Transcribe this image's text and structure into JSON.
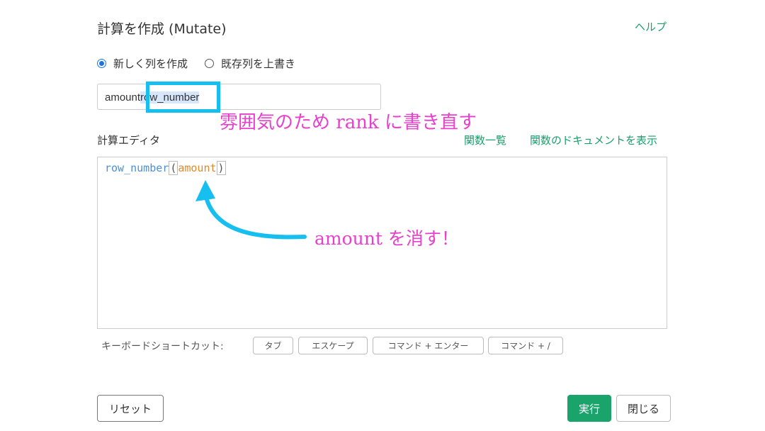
{
  "dialog": {
    "title": "計算を作成 (Mutate)",
    "help_label": "ヘルプ"
  },
  "mode": {
    "options": [
      {
        "label": "新しく列を作成",
        "selected": true
      },
      {
        "label": "既存列を上書き",
        "selected": false
      }
    ]
  },
  "column_name": {
    "value_prefix": "amount",
    "value_selected": "row_number"
  },
  "annotations": {
    "rename_note": "雰囲気のため rank に書き直す",
    "delete_note": "amount を消す！"
  },
  "editor": {
    "label": "計算エディタ",
    "function_list_link": "関数一覧",
    "function_docs_link": "関数のドキュメントを表示",
    "code": {
      "function": "row_number",
      "open_paren": "(",
      "argument": "amount",
      "close_paren": ")"
    }
  },
  "shortcuts": {
    "label": "キーボードショートカット:",
    "keys": [
      "タブ",
      "エスケープ",
      "コマンド + エンター",
      "コマンド + /"
    ]
  },
  "buttons": {
    "reset": "リセット",
    "run": "実行",
    "close": "閉じる"
  },
  "colors": {
    "accent_green": "#1aa36b",
    "annotation_pink": "#e83fcf",
    "highlight_cyan": "#16bff0",
    "code_function": "#4a90d9",
    "code_argument": "#e08a2e"
  }
}
